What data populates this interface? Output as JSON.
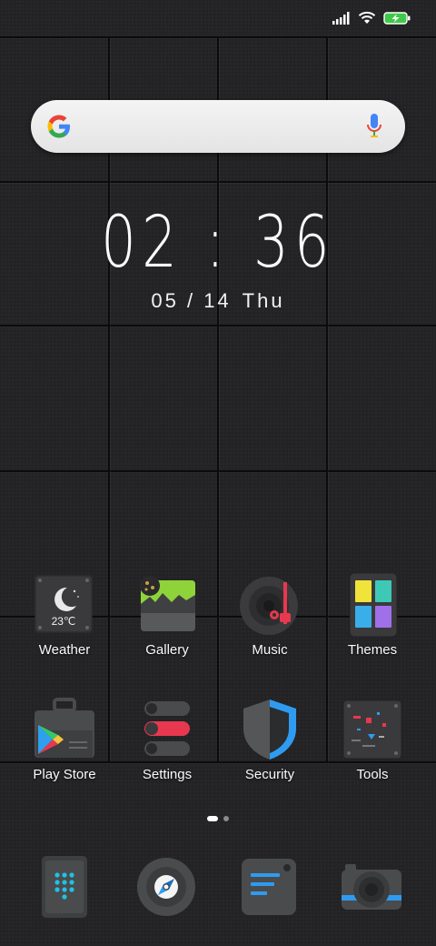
{
  "status_bar": {
    "icons": [
      "signal-icon",
      "wifi-icon",
      "battery-charging-icon"
    ]
  },
  "search": {
    "logo_icon": "google-logo-icon",
    "mic_icon": "mic-icon"
  },
  "clock": {
    "hours": "02",
    "minutes": "36",
    "separator": ":",
    "date": "05 / 14",
    "day": "Thu"
  },
  "apps": [
    {
      "label": "Weather",
      "icon": "weather-icon",
      "temp": "23℃"
    },
    {
      "label": "Gallery",
      "icon": "gallery-icon"
    },
    {
      "label": "Music",
      "icon": "music-icon"
    },
    {
      "label": "Themes",
      "icon": "themes-icon"
    },
    {
      "label": "Play Store",
      "icon": "play-store-icon"
    },
    {
      "label": "Settings",
      "icon": "settings-icon"
    },
    {
      "label": "Security",
      "icon": "security-icon"
    },
    {
      "label": "Tools",
      "icon": "tools-icon"
    }
  ],
  "page_indicator": {
    "pages": 2,
    "active": 1
  },
  "dock": [
    {
      "icon": "phone-dialer-icon"
    },
    {
      "icon": "browser-compass-icon"
    },
    {
      "icon": "messages-icon"
    },
    {
      "icon": "camera-icon"
    }
  ],
  "colors": {
    "accent_blue": "#2f9bf0",
    "accent_red": "#e8384f",
    "accent_cyan": "#1fc2e6"
  }
}
